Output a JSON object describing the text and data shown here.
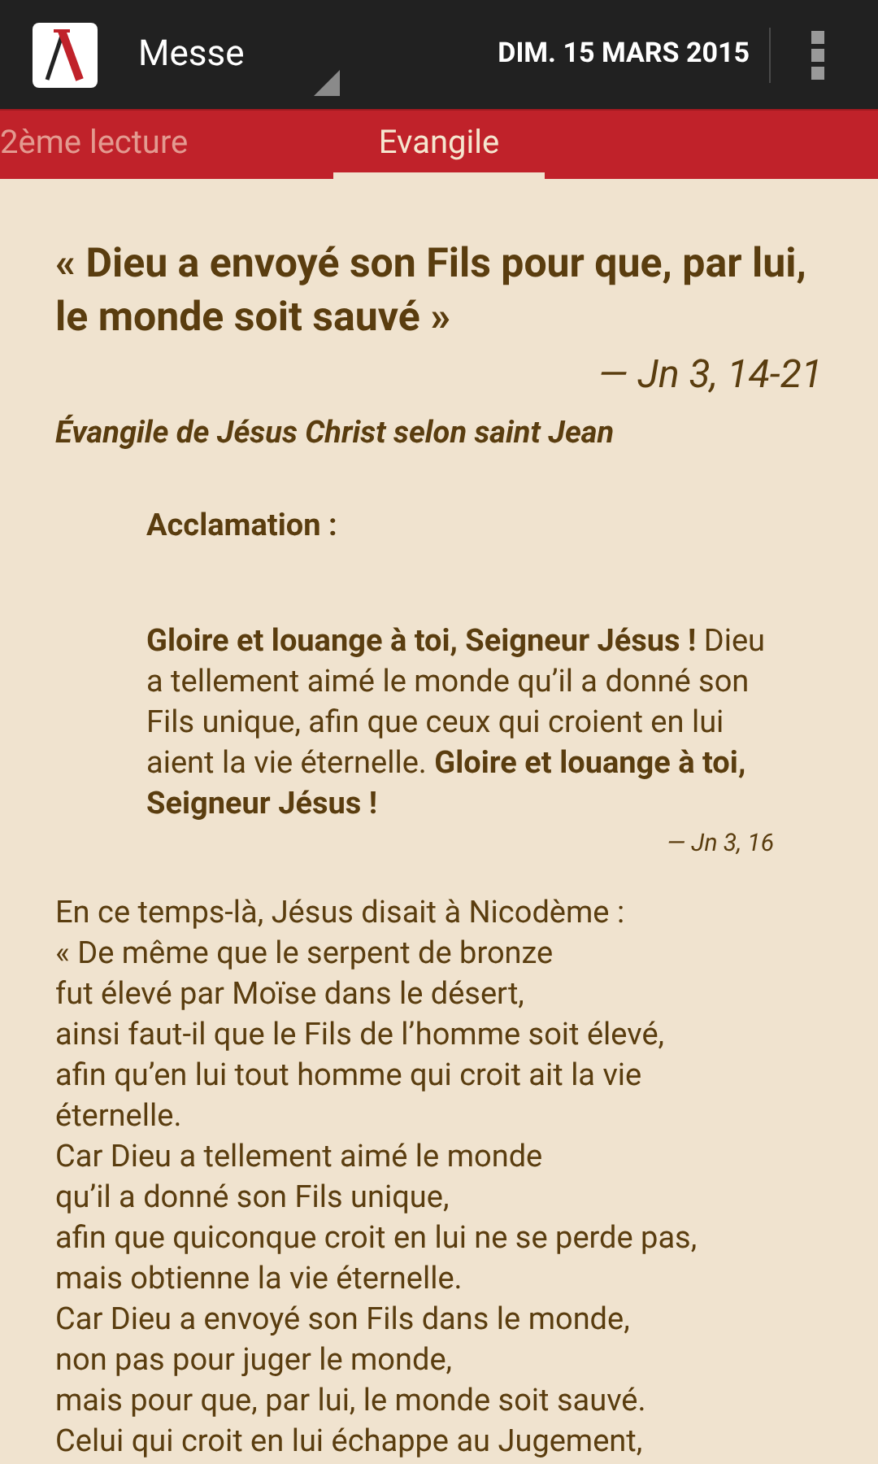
{
  "app_bar": {
    "title": "Messe",
    "date": "DIM. 15 MARS 2015"
  },
  "tabs": [
    {
      "label": "2ème lecture",
      "selected": false
    },
    {
      "label": "Evangile",
      "selected": true
    }
  ],
  "reading": {
    "title": "« Dieu a envoyé son Fils pour que, par lui, le monde soit sauvé »",
    "reference": "— Jn 3, 14-21",
    "source": "Évangile de Jésus Christ selon saint Jean",
    "acclamation": {
      "label": "Acclamation :",
      "text": "**Gloire et louange à toi, Seigneur Jésus !** Dieu a tellement aimé le monde qu’il a donné son Fils unique, afin que ceux qui croient en lui aient la vie éternelle. **Gloire et louange à toi, Seigneur Jésus !**",
      "reference": "— Jn 3, 16"
    },
    "lines": [
      "En ce temps-là, Jésus disait à Nicodème :",
      "« De même que le serpent de bronze",
      "fut élevé par Moïse dans le désert,",
      "ainsi faut-il que le Fils de l’homme soit élevé,",
      "afin qu’en lui tout homme qui croit ait la vie",
      "éternelle.",
      "Car Dieu a tellement aimé le monde",
      "qu’il a donné son Fils unique,",
      "afin que quiconque croit en lui ne se perde pas,",
      "mais obtienne la vie éternelle.",
      "Car Dieu a envoyé son Fils dans le monde,",
      "non pas pour juger le monde,",
      "mais pour que, par lui, le monde soit sauvé.",
      "Celui qui croit en lui échappe au Jugement,"
    ]
  }
}
